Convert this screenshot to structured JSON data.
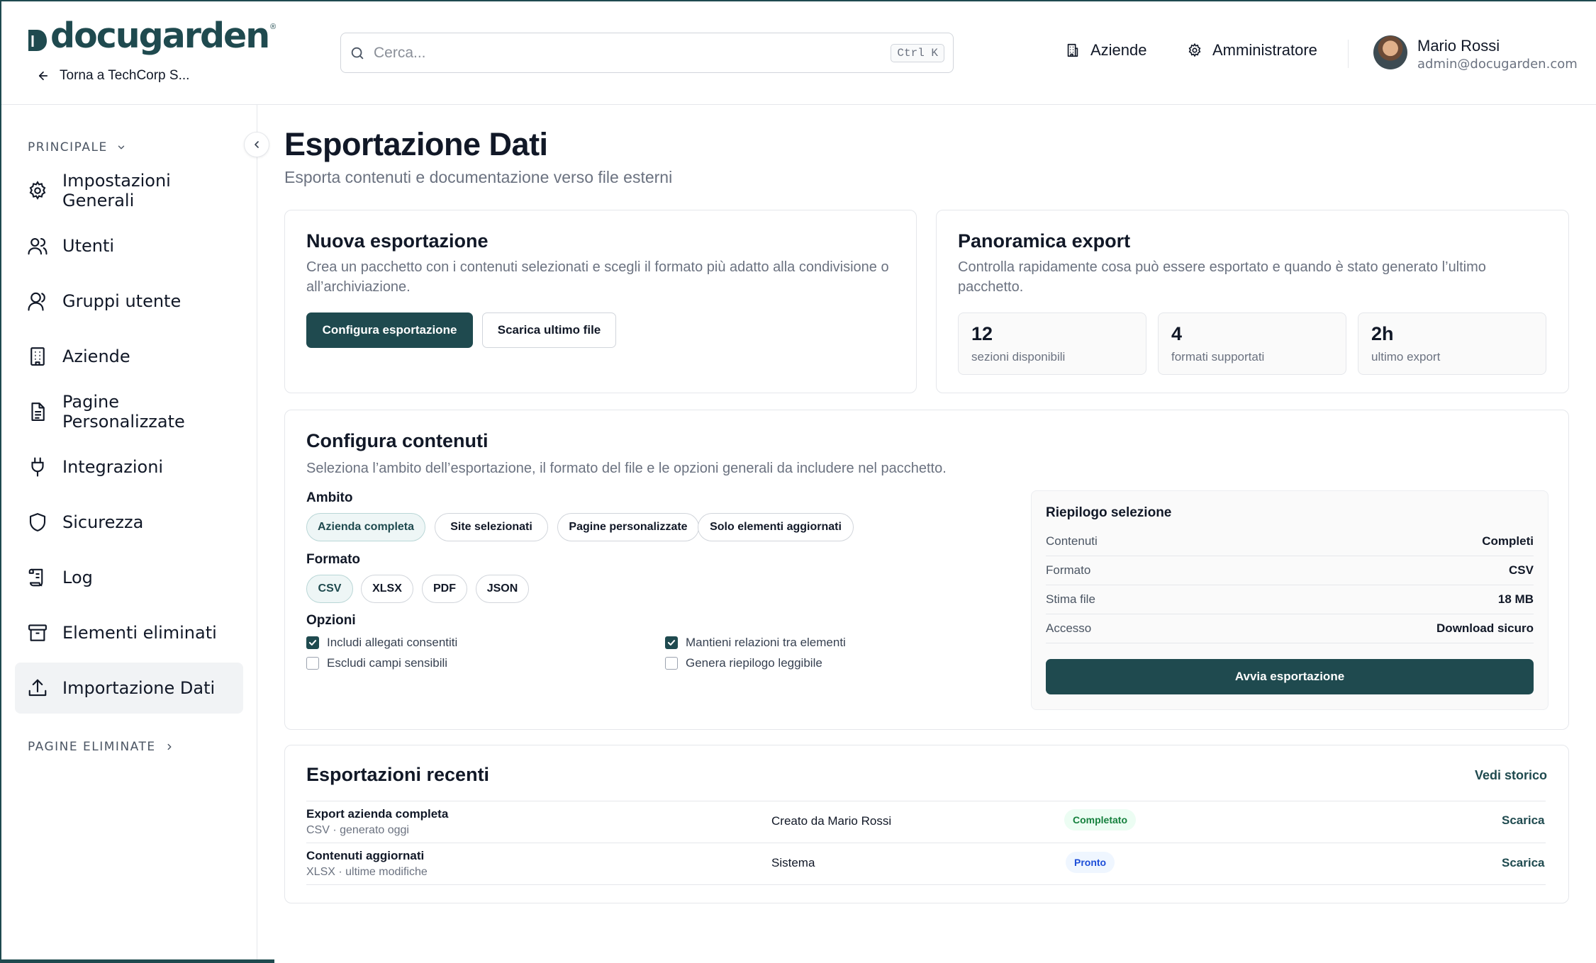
{
  "header": {
    "logo": "docugarden",
    "logo_reg": "®",
    "back_label": "Torna a TechCorp S...",
    "search_placeholder": "Cerca...",
    "search_shortcut": "Ctrl K",
    "nav": {
      "companies": "Aziende",
      "admin": "Amministratore"
    },
    "user": {
      "name": "Mario Rossi",
      "email": "admin@docugarden.com"
    }
  },
  "sidebar": {
    "section_main": "PRINCIPALE",
    "section_deleted": "PAGINE ELIMINATE",
    "items": [
      {
        "label": "Impostazioni Generali",
        "icon": "gear-icon"
      },
      {
        "label": "Utenti",
        "icon": "users-icon"
      },
      {
        "label": "Gruppi utente",
        "icon": "user-group-icon"
      },
      {
        "label": "Aziende",
        "icon": "building-icon"
      },
      {
        "label": "Pagine Personalizzate",
        "icon": "document-icon"
      },
      {
        "label": "Integrazioni",
        "icon": "plug-icon"
      },
      {
        "label": "Sicurezza",
        "icon": "shield-icon"
      },
      {
        "label": "Log",
        "icon": "scroll-icon"
      },
      {
        "label": "Elementi eliminati",
        "icon": "archive-icon"
      },
      {
        "label": "Importazione Dati",
        "icon": "upload-icon",
        "active": true
      }
    ]
  },
  "main": {
    "title": "Esportazione Dati",
    "subtitle": "Esporta contenuti e documentazione verso file esterni",
    "new_export": {
      "title": "Nuova esportazione",
      "desc": "Crea un pacchetto con i contenuti selezionati e scegli il formato più adatto alla condivisione o all’archiviazione.",
      "configure_btn": "Configura esportazione",
      "download_btn": "Scarica ultimo file"
    },
    "overview": {
      "title": "Panoramica export",
      "desc": "Controlla rapidamente cosa può essere esportato e quando è stato generato l’ultimo pacchetto.",
      "stats": [
        {
          "value": "12",
          "label": "sezioni disponibili"
        },
        {
          "value": "4",
          "label": "formati supportati"
        },
        {
          "value": "2h",
          "label": "ultimo export"
        }
      ]
    },
    "configure": {
      "title": "Configura contenuti",
      "desc": "Seleziona l’ambito dell’esportazione, il formato del file e le opzioni generali da includere nel pacchetto.",
      "scope_label": "Ambito",
      "scopes": [
        "Azienda completa",
        "Site selezionati",
        "Pagine personalizzate",
        "Solo elementi aggiornati"
      ],
      "scope_selected": "Azienda completa",
      "format_label": "Formato",
      "formats": [
        "CSV",
        "XLSX",
        "PDF",
        "JSON"
      ],
      "format_selected": "CSV",
      "options_label": "Opzioni",
      "options": [
        {
          "label": "Includi allegati consentiti",
          "checked": true
        },
        {
          "label": "Mantieni relazioni tra elementi",
          "checked": true
        },
        {
          "label": "Escludi campi sensibili",
          "checked": false
        },
        {
          "label": "Genera riepilogo leggibile",
          "checked": false
        }
      ],
      "summary": {
        "title": "Riepilogo selezione",
        "rows": [
          {
            "key": "Contenuti",
            "value": "Completi"
          },
          {
            "key": "Formato",
            "value": "CSV"
          },
          {
            "key": "Stima file",
            "value": "18 MB"
          },
          {
            "key": "Accesso",
            "value": "Download sicuro"
          }
        ],
        "start_btn": "Avvia esportazione"
      }
    },
    "recent": {
      "title": "Esportazioni recenti",
      "history_link": "Vedi storico",
      "rows": [
        {
          "title": "Export azienda completa",
          "sub": "CSV · generato oggi",
          "creator": "Creato da Mario Rossi",
          "status": "Completato",
          "action": "Scarica"
        },
        {
          "title": "Contenuti aggiornati",
          "sub": "XLSX · ultime modifiche",
          "creator": "Sistema",
          "status": "Pronto",
          "action": "Scarica"
        }
      ]
    }
  },
  "colors": {
    "brand": "#1f4a4f",
    "success": "#15803d",
    "info": "#1d4ed8"
  }
}
